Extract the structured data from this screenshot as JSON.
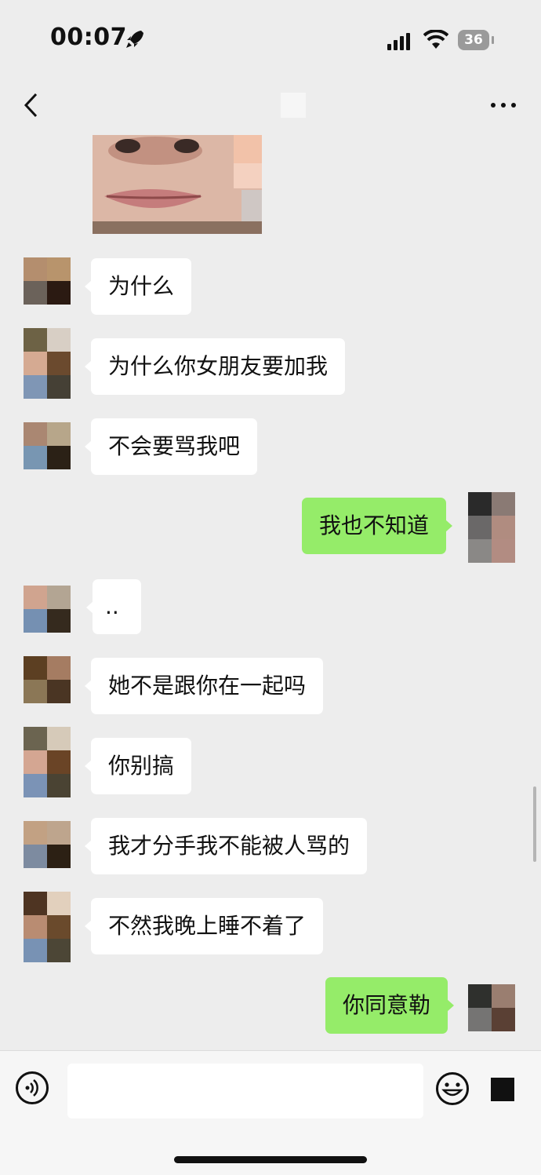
{
  "status_bar": {
    "time": "00:07",
    "battery": "36",
    "icons": [
      "rocket-icon",
      "signal-icon",
      "wifi-icon",
      "battery-icon"
    ]
  },
  "nav": {
    "back_icon": "chevron-left-icon",
    "more_icon": "more-dots-icon"
  },
  "messages": [
    {
      "type": "image",
      "side": "in"
    },
    {
      "side": "in",
      "text": "为什么"
    },
    {
      "side": "in",
      "text": "为什么你女朋友要加我"
    },
    {
      "side": "in",
      "text": "不会要骂我吧"
    },
    {
      "side": "out",
      "text": "我也不知道"
    },
    {
      "side": "in",
      "text": ".."
    },
    {
      "side": "in",
      "text": "她不是跟你在一起吗"
    },
    {
      "side": "in",
      "text": "你别搞"
    },
    {
      "side": "in",
      "text": "我才分手我不能被人骂的"
    },
    {
      "side": "in",
      "text": "不然我晚上睡不着了"
    },
    {
      "side": "out",
      "text": "你同意勒"
    }
  ],
  "input_bar": {
    "placeholder": "",
    "icons": [
      "voice-icon",
      "emoji-icon",
      "plus-icon"
    ]
  },
  "colors": {
    "background": "#ededed",
    "incoming_bubble": "#ffffff",
    "outgoing_bubble": "#95ec69"
  }
}
